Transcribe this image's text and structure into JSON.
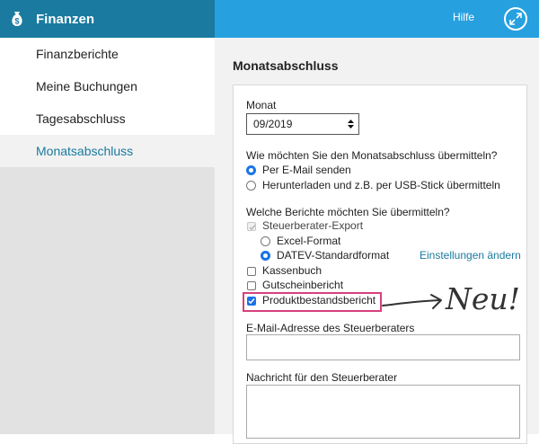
{
  "sidebar": {
    "app_title": "Finanzen",
    "items": [
      {
        "label": "Finanzberichte",
        "active": false
      },
      {
        "label": "Meine Buchungen",
        "active": false
      },
      {
        "label": "Tagesabschluss",
        "active": false
      },
      {
        "label": "Monatsabschluss",
        "active": true
      }
    ]
  },
  "topbar": {
    "help_label": "Hilfe",
    "expand_icon": "expand-icon"
  },
  "main": {
    "page_title": "Monatsabschluss",
    "month": {
      "label": "Monat",
      "value": "09/2019"
    },
    "transmission": {
      "question": "Wie möchten Sie den Monatsabschluss übermitteln?",
      "options": [
        {
          "label": "Per E-Mail senden",
          "checked": true
        },
        {
          "label": "Herunterladen und z.B. per USB-Stick übermitteln",
          "checked": false
        }
      ]
    },
    "reports": {
      "question": "Welche Berichte möchten Sie übermitteln?",
      "tax_export": {
        "label": "Steuerberater-Export",
        "checked": true,
        "disabled": true,
        "formats": [
          {
            "label": "Excel-Format",
            "checked": false
          },
          {
            "label": "DATEV-Standardformat",
            "checked": true
          }
        ],
        "settings_link": "Einstellungen ändern"
      },
      "cashbook": {
        "label": "Kassenbuch",
        "checked": false
      },
      "voucher": {
        "label": "Gutscheinbericht",
        "checked": false
      },
      "product_stock": {
        "label": "Produktbestandsbericht",
        "checked": true
      }
    },
    "email": {
      "label": "E-Mail-Adresse des Steuerberaters",
      "value": ""
    },
    "message": {
      "label": "Nachricht für den Steuerberater",
      "value": ""
    }
  },
  "annotation": {
    "text": "Neu!",
    "color": "#333333"
  },
  "colors": {
    "sidebar_header": "#1a7aa0",
    "topbar": "#27a0e0",
    "accent": "#1a7aa0",
    "highlight": "#d6407e",
    "checked": "#1a73e8"
  }
}
